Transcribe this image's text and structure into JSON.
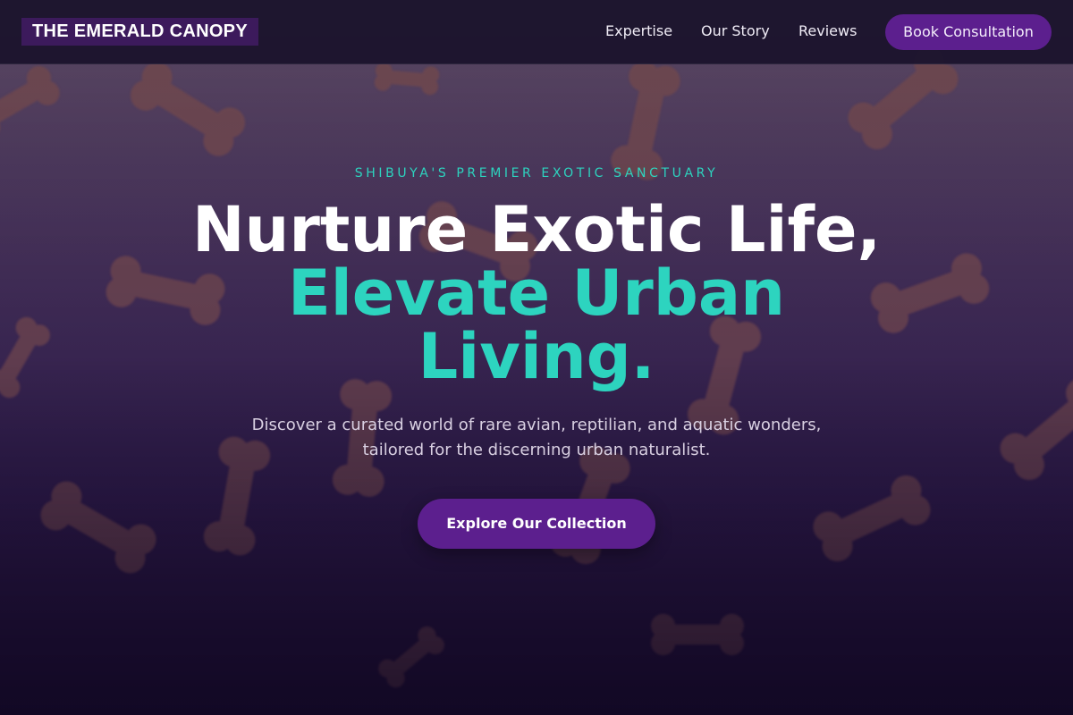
{
  "nav": {
    "brand": "THE EMERALD CANOPY",
    "links": [
      "Expertise",
      "Our Story",
      "Reviews"
    ],
    "cta": "Book Consultation"
  },
  "hero": {
    "eyebrow": "SHIBUYA'S PREMIER EXOTIC SANCTUARY",
    "headline_line1": "Nurture Exotic Life,",
    "headline_line2": "Elevate Urban",
    "headline_line3": "Living.",
    "subtext": "Discover a curated world of rare avian, reptilian, and aquatic wonders, tailored for the discerning urban naturalist.",
    "cta": "Explore Our Collection",
    "background_image": "dog-bone-biscuits-photo"
  },
  "colors": {
    "accent_teal": "#2dd4bf",
    "brand_purple": "#5c1f8e",
    "nav_bg": "#1c142e",
    "brand_bg": "#3c1a5c"
  }
}
